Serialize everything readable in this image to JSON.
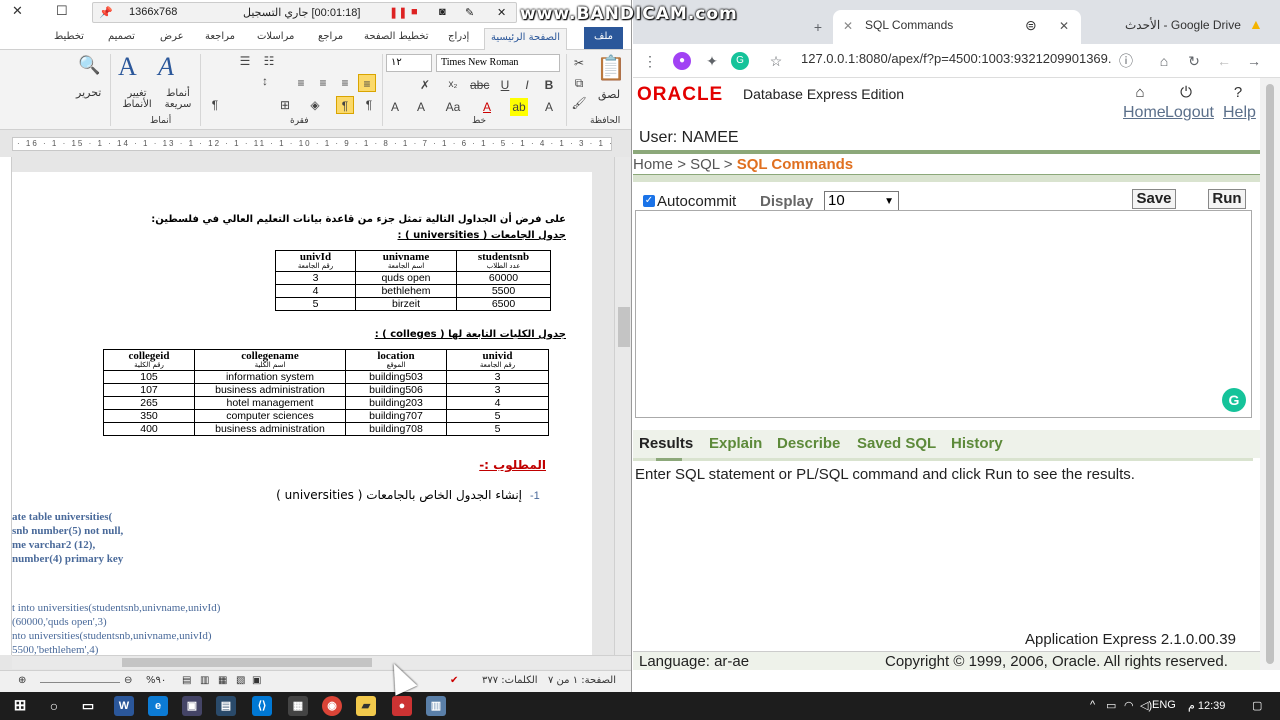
{
  "word": {
    "recorder": {
      "resolution": "1366x768",
      "timer": "[00:01:18] جاري التسجيل"
    },
    "tabs": [
      "ملف",
      "الصفحة الرئيسية",
      "إدراج",
      "تخطيط الصفحة",
      "مراجع",
      "مراسلات",
      "مراجعة",
      "عرض",
      "تصميم",
      "تخطيط"
    ],
    "ribbon": {
      "font_name": "Times New Roman",
      "font_size": "١٢",
      "groups": {
        "clipboard": "الحافظة",
        "font": "خط",
        "paragraph": "فقرة",
        "styles": "أنماط"
      },
      "paste": "لصق",
      "quick_styles": "أنماط سريعة",
      "change_styles": "تغيير الأنماط",
      "editing": "تحرير"
    },
    "ruler_marks": "· 16 · 1 · 15 · 1 · 14 · 1 · 13 · 1 · 12 · 1 · 11 · 1 · 10 · 1 · 9 · 1 · 8 · 1 · 7 · 1 · 6 · 1 · 5 · 1 · 4 · 1 · 3 · 1 · 2 · 1 · 1 · 1 ·",
    "doc": {
      "intro": "على فرض أن الجداول التالية تمثل جزء من قاعدة بيانات التعليم العالي في فلسطين:",
      "t1_caption": "جدول الجامعات ( universities ) :",
      "t1_headers": [
        {
          "en": "univId",
          "ar": "رقم الجامعة"
        },
        {
          "en": "univname",
          "ar": "اسم الجامعة"
        },
        {
          "en": "studentsnb",
          "ar": "عدد الطلاب"
        }
      ],
      "t1_rows": [
        [
          "3",
          "quds open",
          "60000"
        ],
        [
          "4",
          "bethlehem",
          "5500"
        ],
        [
          "5",
          "birzeit",
          "6500"
        ]
      ],
      "t2_caption": "جدول الكليات التابعة لها ( colleges ) :",
      "t2_headers": [
        {
          "en": "collegeid",
          "ar": "رقم الكلية"
        },
        {
          "en": "collegename",
          "ar": "اسم الكلية"
        },
        {
          "en": "location",
          "ar": "الموقع"
        },
        {
          "en": "univid",
          "ar": "رقم الجامعة"
        }
      ],
      "t2_rows": [
        [
          "105",
          "information system",
          "building503",
          "3"
        ],
        [
          "107",
          "business administration",
          "building506",
          "3"
        ],
        [
          "265",
          "hotel management",
          "building203",
          "4"
        ],
        [
          "350",
          "computer sciences",
          "building707",
          "5"
        ],
        [
          "400",
          "business administration",
          "building708",
          "5"
        ]
      ],
      "required": "المطلوب :-",
      "task1_num": "-1",
      "task1": "إنشاء الجدول الخاص بالجامعات ( universities )",
      "code": [
        "ate table universities(",
        "snb  number(5) not null,",
        "me varchar2 (12),",
        "number(4) primary key",
        "",
        "",
        "t into  universities(studentsnb,univname,univId)",
        "(60000,'quds open',3)",
        "nto  universities(studentsnb,univname,univId)",
        "5500,'bethlehem',4)"
      ]
    },
    "status": {
      "page": "الصفحة: ١ من ٧",
      "words": "الكلمات: ٣٧٧",
      "zoom": "%٩٠"
    }
  },
  "watermark": {
    "brand": "www.BANDICAM.com"
  },
  "browser": {
    "tabs": [
      {
        "label": "SQL Commands",
        "active": true
      },
      {
        "label": "Google Drive - الأحدث",
        "active": false
      }
    ],
    "url": "127.0.0.1:8080/apex/f?p=4500:1003:9321209901369...",
    "apex": {
      "logo": "ORACLE",
      "product": "Database Express Edition",
      "nav": [
        "Home",
        "Logout",
        "Help"
      ],
      "user": "User: NAMEE",
      "breadcrumb": {
        "home": "Home",
        "sep": ">",
        "sql": "SQL",
        "current": "SQL Commands"
      },
      "autocommit": "Autocommit",
      "display_label": "Display",
      "display_value": "10",
      "save": "Save",
      "run": "Run",
      "result_tabs": [
        "Results",
        "Explain",
        "Describe",
        "Saved SQL",
        "History"
      ],
      "message": "Enter SQL statement or PL/SQL command and click Run to see the results.",
      "version": "Application Express 2.1.0.00.39",
      "language": "Language: ar-ae",
      "copyright": "Copyright © 1999, 2006, Oracle. All rights reserved."
    }
  },
  "taskbar": {
    "lang": "ENG",
    "time": "12:39 م"
  }
}
